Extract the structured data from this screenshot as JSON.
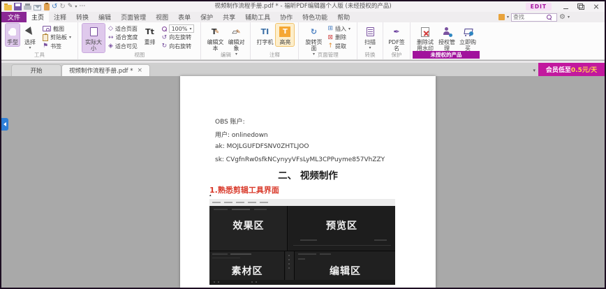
{
  "titlebar": {
    "title": "视频制作流程手册.pdf * - 福昕PDF编辑器个人版 (未经授权的产品)",
    "edit_badge": "EDIT"
  },
  "qat_icons": [
    "open-folder",
    "save",
    "print",
    "email",
    "paste",
    "undo",
    "redo",
    "signature",
    "more"
  ],
  "ribbon_tabs": {
    "file": "文件",
    "items": [
      "主页",
      "注释",
      "转换",
      "编辑",
      "页面管理",
      "视图",
      "表单",
      "保护",
      "共享",
      "辅助工具",
      "协作",
      "特色功能",
      "帮助"
    ],
    "active": "主页"
  },
  "find": {
    "placeholder": "查找"
  },
  "ribbon": {
    "groups": [
      {
        "label": "工具",
        "items": [
          {
            "label": "手型"
          },
          {
            "label": "选择"
          },
          {
            "label": "截图"
          },
          {
            "label": "剪贴板"
          },
          {
            "label": "书签"
          }
        ]
      },
      {
        "label": "视图",
        "items": [
          {
            "label": "实际大小"
          },
          {
            "label": "适合页面"
          },
          {
            "label": "适合宽度"
          },
          {
            "label": "适合可见"
          },
          {
            "label": "重排"
          },
          {
            "label": "100%"
          },
          {
            "label": "向左旋转"
          },
          {
            "label": "向右旋转"
          }
        ]
      },
      {
        "label": "编辑",
        "items": [
          {
            "label": "编辑文本"
          },
          {
            "label": "编辑对象"
          }
        ]
      },
      {
        "label": "注释",
        "items": [
          {
            "label": "打字机"
          },
          {
            "label": "高亮"
          }
        ]
      },
      {
        "label": "页面管理",
        "items": [
          {
            "label": "旋转页面"
          },
          {
            "label": "插入"
          },
          {
            "label": "删除"
          },
          {
            "label": "提取"
          }
        ]
      },
      {
        "label": "转换",
        "items": [
          {
            "label": "扫描"
          }
        ]
      },
      {
        "label": "保护",
        "items": [
          {
            "label": "PDF签名"
          }
        ]
      },
      {
        "label": "未授权的产品",
        "items": [
          {
            "label": "删除试用水印"
          },
          {
            "label": "授权管理"
          },
          {
            "label": "立即购买"
          }
        ]
      }
    ]
  },
  "doc_tabs": {
    "start": "开始",
    "active": "视频制作流程手册.pdf *",
    "close_glyph": "×"
  },
  "promo": {
    "prefix": "会员低至",
    "price": "0.5元/天"
  },
  "page": {
    "lines": [
      "OBS 账户:",
      "用户: onlinedown",
      "ak: MOJLGUFDFSNV0ZHTLJOO",
      "sk: CVgfnRw0sfkNCynyyVFsLyML3CPPuyme857VhZZY"
    ],
    "heading": "二、 视频制作",
    "subheading": "1.熟悉剪辑工具界面",
    "shot_labels": [
      "效果区",
      "预览区",
      "素材区",
      "编辑区"
    ]
  },
  "colors": {
    "accent_purple": "#8a2794",
    "unlicensed_bar": "#a1129c",
    "promo_magenta": "#c2189e",
    "highlight_orange": "#f5a733",
    "heading_red": "#d93a2b",
    "workspace_gray": "#a9a9a9"
  }
}
